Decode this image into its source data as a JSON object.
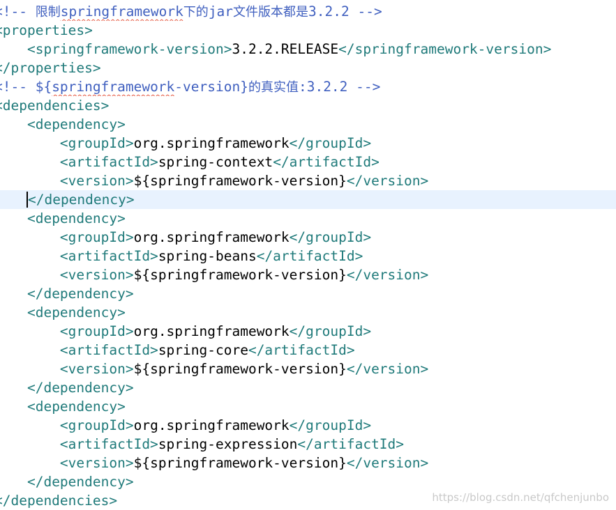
{
  "colors": {
    "comment": "#3f5fbf",
    "tag": "#1f7a7a",
    "text": "#000000",
    "current_line": "#e8f2fe",
    "squiggle": "#e5533a",
    "watermark": "#c9c9c9"
  },
  "lines": [
    {
      "indent": "",
      "segs": [
        {
          "c": "comment",
          "t": "<!-- "
        },
        {
          "c": "comment cjk",
          "t": "限制"
        },
        {
          "c": "comment squiggle",
          "t": "springframework"
        },
        {
          "c": "comment cjk",
          "t": "下的"
        },
        {
          "c": "comment",
          "t": "jar"
        },
        {
          "c": "comment cjk",
          "t": "文件版本都是"
        },
        {
          "c": "comment",
          "t": "3.2.2 -->"
        }
      ]
    },
    {
      "indent": "",
      "segs": [
        {
          "c": "tag",
          "t": "<properties>"
        }
      ]
    },
    {
      "indent": "    ",
      "segs": [
        {
          "c": "tag",
          "t": "<springframework-version>"
        },
        {
          "c": "text",
          "t": "3.2.2.RELEASE"
        },
        {
          "c": "tag",
          "t": "</springframework-version>"
        }
      ]
    },
    {
      "indent": "",
      "segs": [
        {
          "c": "tag",
          "t": "</properties>"
        }
      ]
    },
    {
      "indent": "",
      "segs": [
        {
          "c": "comment",
          "t": "<!-- ${"
        },
        {
          "c": "comment squiggle",
          "t": "springframework"
        },
        {
          "c": "comment",
          "t": "-version}"
        },
        {
          "c": "comment cjk",
          "t": "的真实值"
        },
        {
          "c": "comment",
          "t": ":3.2.2 -->"
        }
      ]
    },
    {
      "indent": "",
      "segs": [
        {
          "c": "tag",
          "t": "<dependencies>"
        }
      ]
    },
    {
      "indent": "    ",
      "segs": [
        {
          "c": "tag",
          "t": "<dependency>"
        }
      ]
    },
    {
      "indent": "        ",
      "segs": [
        {
          "c": "tag",
          "t": "<groupId>"
        },
        {
          "c": "text",
          "t": "org.springframework"
        },
        {
          "c": "tag",
          "t": "</groupId>"
        }
      ]
    },
    {
      "indent": "        ",
      "segs": [
        {
          "c": "tag",
          "t": "<artifactId>"
        },
        {
          "c": "text",
          "t": "spring-context"
        },
        {
          "c": "tag",
          "t": "</artifactId>"
        }
      ]
    },
    {
      "indent": "        ",
      "segs": [
        {
          "c": "tag",
          "t": "<version>"
        },
        {
          "c": "text",
          "t": "${springframework-version}"
        },
        {
          "c": "tag",
          "t": "</version>"
        }
      ]
    },
    {
      "indent": "    ",
      "current": true,
      "segs": [
        {
          "c": "tag caret-mark",
          "t": "<"
        },
        {
          "c": "tag",
          "t": "/dependency>"
        }
      ]
    },
    {
      "indent": "    ",
      "segs": [
        {
          "c": "tag",
          "t": "<dependency>"
        }
      ]
    },
    {
      "indent": "        ",
      "segs": [
        {
          "c": "tag",
          "t": "<groupId>"
        },
        {
          "c": "text",
          "t": "org.springframework"
        },
        {
          "c": "tag",
          "t": "</groupId>"
        }
      ]
    },
    {
      "indent": "        ",
      "segs": [
        {
          "c": "tag",
          "t": "<artifactId>"
        },
        {
          "c": "text",
          "t": "spring-beans"
        },
        {
          "c": "tag",
          "t": "</artifactId>"
        }
      ]
    },
    {
      "indent": "        ",
      "segs": [
        {
          "c": "tag",
          "t": "<version>"
        },
        {
          "c": "text",
          "t": "${springframework-version}"
        },
        {
          "c": "tag",
          "t": "</version>"
        }
      ]
    },
    {
      "indent": "    ",
      "segs": [
        {
          "c": "tag",
          "t": "</dependency>"
        }
      ]
    },
    {
      "indent": "    ",
      "segs": [
        {
          "c": "tag",
          "t": "<dependency>"
        }
      ]
    },
    {
      "indent": "        ",
      "segs": [
        {
          "c": "tag",
          "t": "<groupId>"
        },
        {
          "c": "text",
          "t": "org.springframework"
        },
        {
          "c": "tag",
          "t": "</groupId>"
        }
      ]
    },
    {
      "indent": "        ",
      "segs": [
        {
          "c": "tag",
          "t": "<artifactId>"
        },
        {
          "c": "text",
          "t": "spring-core"
        },
        {
          "c": "tag",
          "t": "</artifactId>"
        }
      ]
    },
    {
      "indent": "        ",
      "segs": [
        {
          "c": "tag",
          "t": "<version>"
        },
        {
          "c": "text",
          "t": "${springframework-version}"
        },
        {
          "c": "tag",
          "t": "</version>"
        }
      ]
    },
    {
      "indent": "    ",
      "segs": [
        {
          "c": "tag",
          "t": "</dependency>"
        }
      ]
    },
    {
      "indent": "    ",
      "segs": [
        {
          "c": "tag",
          "t": "<dependency>"
        }
      ]
    },
    {
      "indent": "        ",
      "segs": [
        {
          "c": "tag",
          "t": "<groupId>"
        },
        {
          "c": "text",
          "t": "org.springframework"
        },
        {
          "c": "tag",
          "t": "</groupId>"
        }
      ]
    },
    {
      "indent": "        ",
      "segs": [
        {
          "c": "tag",
          "t": "<artifactId>"
        },
        {
          "c": "text",
          "t": "spring-expression"
        },
        {
          "c": "tag",
          "t": "</artifactId>"
        }
      ]
    },
    {
      "indent": "        ",
      "segs": [
        {
          "c": "tag",
          "t": "<version>"
        },
        {
          "c": "text",
          "t": "${springframework-version}"
        },
        {
          "c": "tag",
          "t": "</version>"
        }
      ]
    },
    {
      "indent": "    ",
      "segs": [
        {
          "c": "tag",
          "t": "</dependency>"
        }
      ]
    },
    {
      "indent": "",
      "segs": [
        {
          "c": "tag",
          "t": "</dependencies>"
        }
      ]
    }
  ],
  "watermark": "https://blog.csdn.net/qfchenjunbo"
}
